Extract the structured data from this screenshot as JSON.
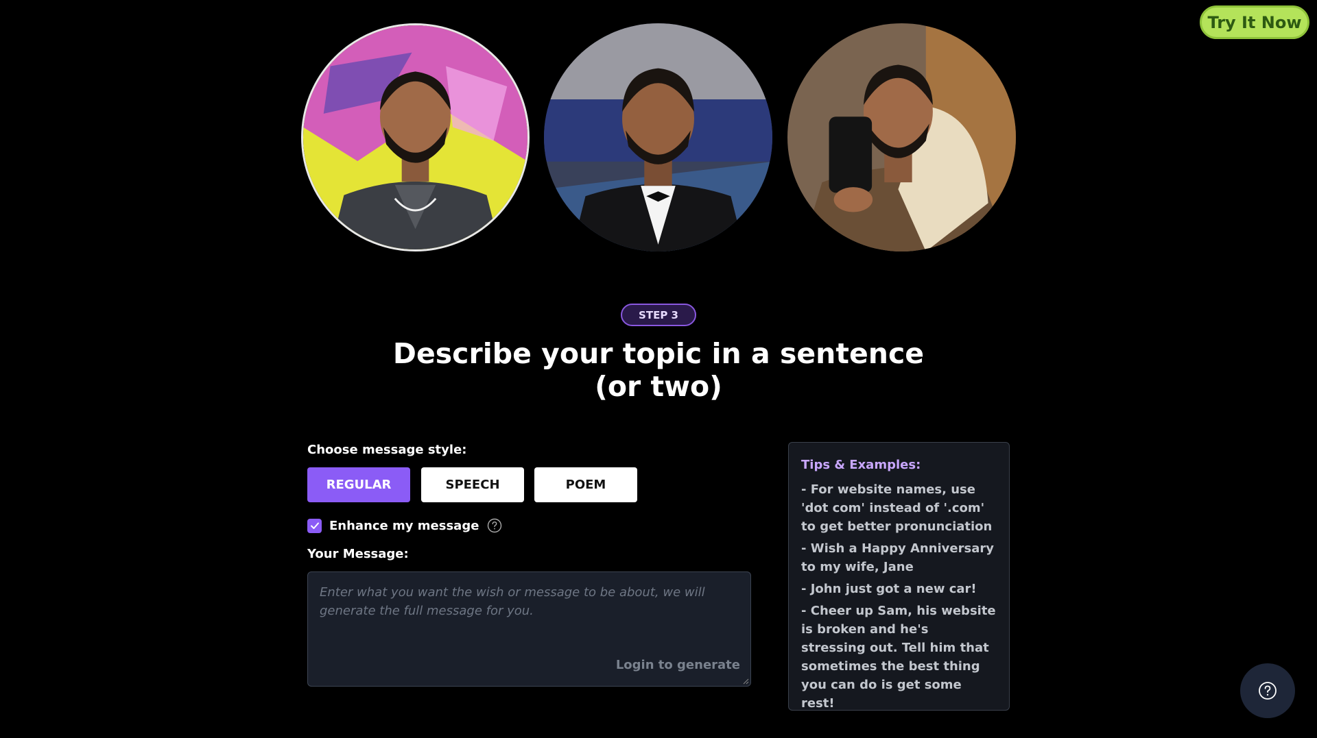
{
  "header": {
    "try_button_label": "Try It Now"
  },
  "gallery": {
    "avatars": [
      {
        "icon": "person-portrait-icon",
        "colors": [
          "#e4e436",
          "#d04fc8"
        ]
      },
      {
        "icon": "person-portrait-icon",
        "colors": [
          "#39415a",
          "#9a9aa2"
        ]
      },
      {
        "icon": "person-portrait-icon",
        "colors": [
          "#7a6450",
          "#e9dcc0"
        ]
      }
    ]
  },
  "step": {
    "badge": "STEP 3",
    "heading_line1": "Describe your topic in a sentence",
    "heading_line2": "(or two)"
  },
  "form": {
    "style_label": "Choose message style:",
    "styles": [
      "REGULAR",
      "SPEECH",
      "POEM"
    ],
    "selected_style": "REGULAR",
    "enhance_label": "Enhance my message",
    "enhance_checked": true,
    "message_label": "Your Message:",
    "message_placeholder": "Enter what you want the wish or message to be about, we will generate the full message for you.",
    "generate_label": "Login to generate"
  },
  "tips": {
    "title": "Tips & Examples:",
    "items": [
      "- For website names, use 'dot com' instead of '.com' to get better pronunciation",
      "- Wish a Happy Anniversary to my wife, Jane",
      "- John just got a new car!",
      "- Cheer up Sam, his website is broken and he's stressing out. Tell him that sometimes the best thing you can do is get some rest!"
    ]
  },
  "colors": {
    "accent": "#8b5cf6",
    "cta": "#b4e35a",
    "tips_title": "#c9a7ff",
    "background": "#000000"
  }
}
